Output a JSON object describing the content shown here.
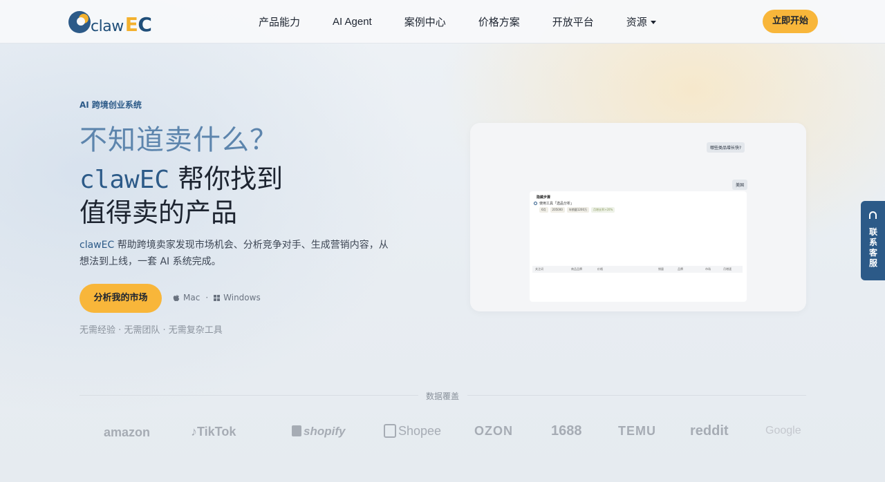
{
  "nav": {
    "logo_prefix": "claw",
    "logo_e": "E",
    "logo_c": "C",
    "menu": [
      {
        "label": "产品能力"
      },
      {
        "label": "AI Agent"
      },
      {
        "label": "案例中心"
      },
      {
        "label": "价格方案"
      },
      {
        "label": "开放平台"
      },
      {
        "label": "资源"
      }
    ],
    "cta": "立即开始"
  },
  "hero": {
    "eyebrow": "AI 跨境创业系统",
    "line1": "不知道卖什么？",
    "brand": "clawEC",
    "line2_rest": " 帮你找到",
    "line3": "值得卖的产品",
    "desc_brand": "clawEC",
    "desc_rest": " 帮助跨境卖家发现市场机会、分析竞争对手、生成营销内容，从想法到上线，一套 AI 系统完成。",
    "cta": "分析我的市场",
    "platform_mac": "Mac",
    "platform_sep": "·",
    "platform_windows": "Windows",
    "note": "无需经验 · 无需团队 · 无需复杂工具"
  },
  "preview": {
    "question": "哪些类品增长快?",
    "region": "美国",
    "inner_title": "隐藏步骤",
    "inner_step": "使用工具「选品分析」",
    "chips": [
      "6月",
      "205000",
      "年销量1200万",
      "月增长率>20%"
    ],
    "table_headers": [
      "关注词",
      "商品品牌",
      "价格",
      "销量",
      "品牌",
      "市场",
      "月增速"
    ]
  },
  "support": {
    "label": "联系客服"
  },
  "coverage": {
    "title": "数据覆盖",
    "logos": [
      "amazon",
      "TikTok",
      "shopify",
      "Shopee",
      "OZON",
      "1688",
      "TEMU",
      "reddit",
      "Google"
    ]
  },
  "colors": {
    "accent": "#f8b63a",
    "brand_blue": "#2c5a88"
  }
}
